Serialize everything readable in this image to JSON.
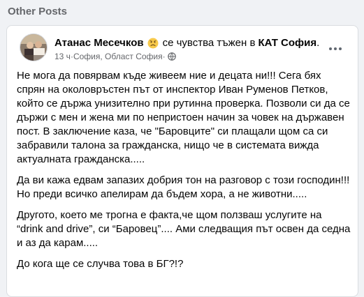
{
  "section": {
    "title": "Other Posts"
  },
  "post": {
    "author": "Атанас Месечков",
    "feeling_icon": "sad-face-emoji",
    "feeling_text": "се чувства тъжен в",
    "place": "КАТ София",
    "place_suffix": ".",
    "time": "13 ч",
    "separator": " · ",
    "location": "София, Област София",
    "privacy_icon": "globe-icon",
    "more_icon": "more-options-icon",
    "paragraphs": [
      "Не мога да повярвам къде живеем ние и децата ни!!! Сега бях спрян на околовръстен път от инспектор Иван Руменов Петков, който се държа унизително при рутинна проверка. Позволи си да се държи с мен и жена ми по непристоен начин за човек на държавен пост. В заключение каза, че \"Баровците\" си плащали щом са си забравили талона за гражданска, нищо че в системата виждa актуалната гражданска.....",
      "Да ви кажа едвам запазих добрия тон на разговор с този господин!!! Но преди всичко апелирам да бъдем хора, а не животни.....",
      "Другото, което ме трогна е факта,че щом ползваш услугите на “drink and drive”, си “Баровец”....  Ами следващия път освен да седна и аз да карам.....",
      "До кога ще се случва това в БГ?!?"
    ]
  },
  "colors": {
    "page_bg": "#f0f2f5",
    "card_bg": "#ffffff",
    "secondary_text": "#65676b",
    "primary_text": "#050505"
  }
}
